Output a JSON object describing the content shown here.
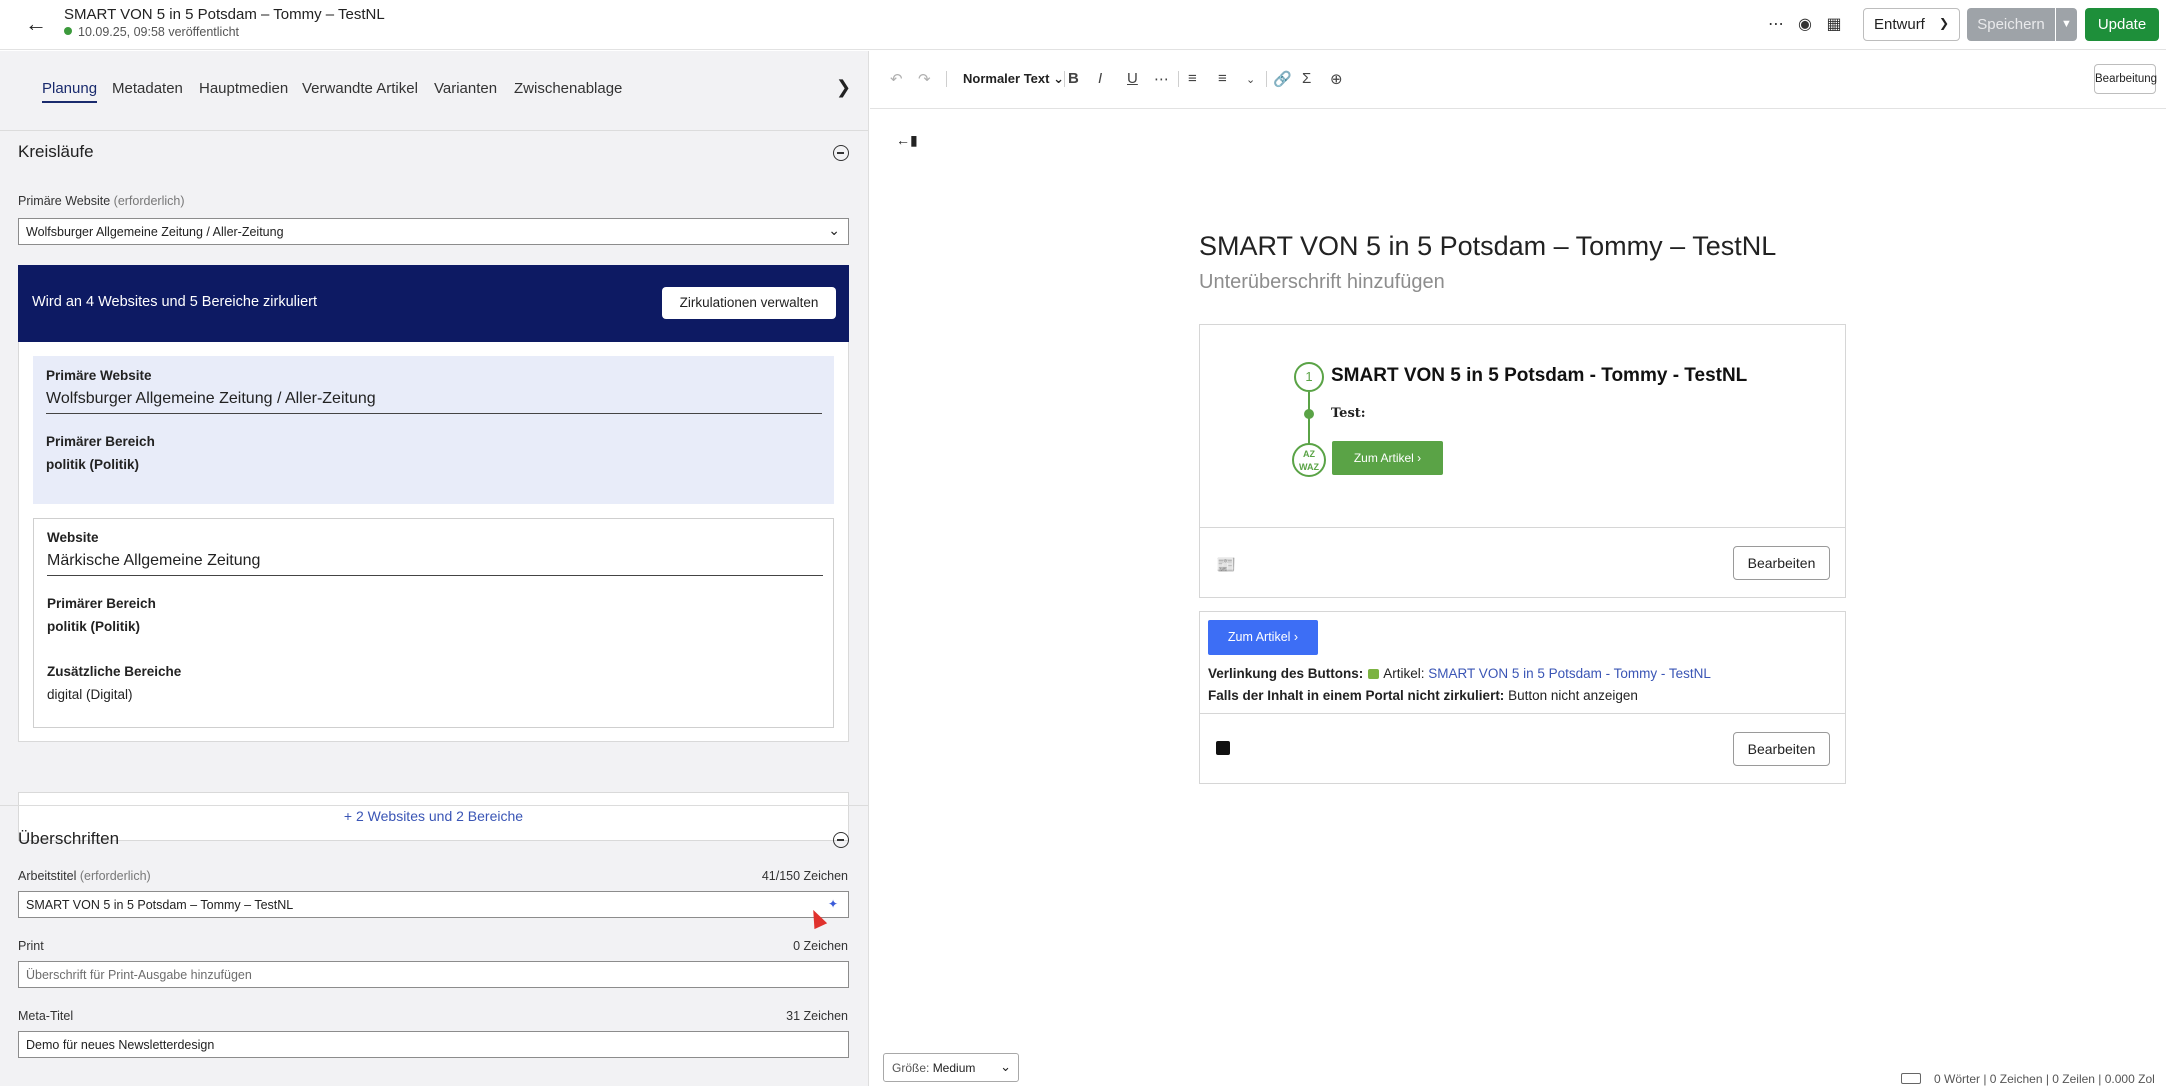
{
  "header": {
    "title": "SMART VON 5 in 5 Potsdam – Tommy – TestNL",
    "status": "10.09.25, 09:58 veröffentlicht",
    "state_value": "Entwurf",
    "save_label": "Speichern",
    "update_label": "Update",
    "icons": [
      "back-arrow-icon",
      "more-horizontal-icon",
      "globe-icon",
      "calendar-icon",
      "chevron-down-icon"
    ]
  },
  "tabs": [
    "Planung",
    "Metadaten",
    "Hauptmedien",
    "Verwandte Artikel",
    "Varianten",
    "Zwischenablage"
  ],
  "circulation": {
    "section_title": "Kreisläufe",
    "primary_site_label": "Primäre Website",
    "primary_site_optional": "(erforderlich)",
    "primary_site_value": "Wolfsburger Allgemeine Zeitung / Aller-Zeitung",
    "banner_text": "Wird an 4 Websites und 5 Bereiche zirkuliert",
    "banner_button": "Zirkulationen verwalten",
    "card1": {
      "site_label": "Primäre Website",
      "site_value": "Wolfsburger Allgemeine Zeitung / Aller-Zeitung",
      "section_label": "Primärer Bereich",
      "section_value": "politik  (Politik)"
    },
    "card2": {
      "site_label": "Website",
      "site_value": "Märkische Allgemeine Zeitung",
      "section_label": "Primärer Bereich",
      "section_value": "politik  (Politik)",
      "extra_label": "Zusätzliche Bereiche",
      "extra_value": "digital  (Digital)"
    },
    "more_link": "+ 2 Websites und 2 Bereiche"
  },
  "headlines": {
    "section_title": "Überschriften",
    "working_title_label": "Arbeitstitel",
    "working_title_optional": "(erforderlich)",
    "working_title_count": "41/150 Zeichen",
    "working_title_value": "SMART VON 5 in 5 Potsdam – Tommy – TestNL",
    "print_label": "Print",
    "print_count": "0 Zeichen",
    "print_placeholder": "Überschrift für Print-Ausgabe hinzufügen",
    "meta_label": "Meta-Titel",
    "meta_count": "31 Zeichen",
    "meta_value": "Demo für neues Newsletterdesign"
  },
  "toolbar": {
    "format": "Normaler Text",
    "mode_button": "Bearbeitung",
    "icons": [
      "undo-icon",
      "redo-icon",
      "bold-icon",
      "italic-icon",
      "underline-icon",
      "more-icon",
      "bullet-list-icon",
      "numbered-list-icon",
      "link-icon",
      "sigma-icon",
      "add-circle-icon"
    ]
  },
  "editor": {
    "headline": "SMART VON 5 in 5 Potsdam – Tommy – TestNL",
    "subheadline_placeholder": "Unterüberschrift hinzufügen",
    "newsletter_block": {
      "step_number": "1",
      "title": "SMART VON 5 in 5 Potsdam - Tommy - TestNL",
      "test_label": "Test:",
      "logo_text": "AZ WAZ",
      "button_label": "Zum Artikel  ›",
      "edit_label": "Bearbeiten"
    },
    "button_block": {
      "button_label": "Zum Artikel  ›",
      "link_label": "Verlinkung des Buttons:",
      "link_prefix": "Artikel:",
      "link_target": "SMART VON 5 in 5 Potsdam - Tommy - TestNL",
      "portal_label": "Falls der Inhalt in einem Portal nicht zirkuliert:",
      "portal_value": "Button nicht anzeigen",
      "edit_label": "Bearbeiten"
    }
  },
  "footer": {
    "size_label": "Größe:",
    "size_value": "Medium",
    "wordcount": "0 Wörter | 0 Zeichen | 0 Zeilen | 0.000 Zol"
  },
  "colors": {
    "banner": "#0d1a63",
    "update": "#1e8f3a",
    "newsletter_green": "#5aa346",
    "button_blue": "#3d6ef5",
    "link": "#3a55b5"
  }
}
